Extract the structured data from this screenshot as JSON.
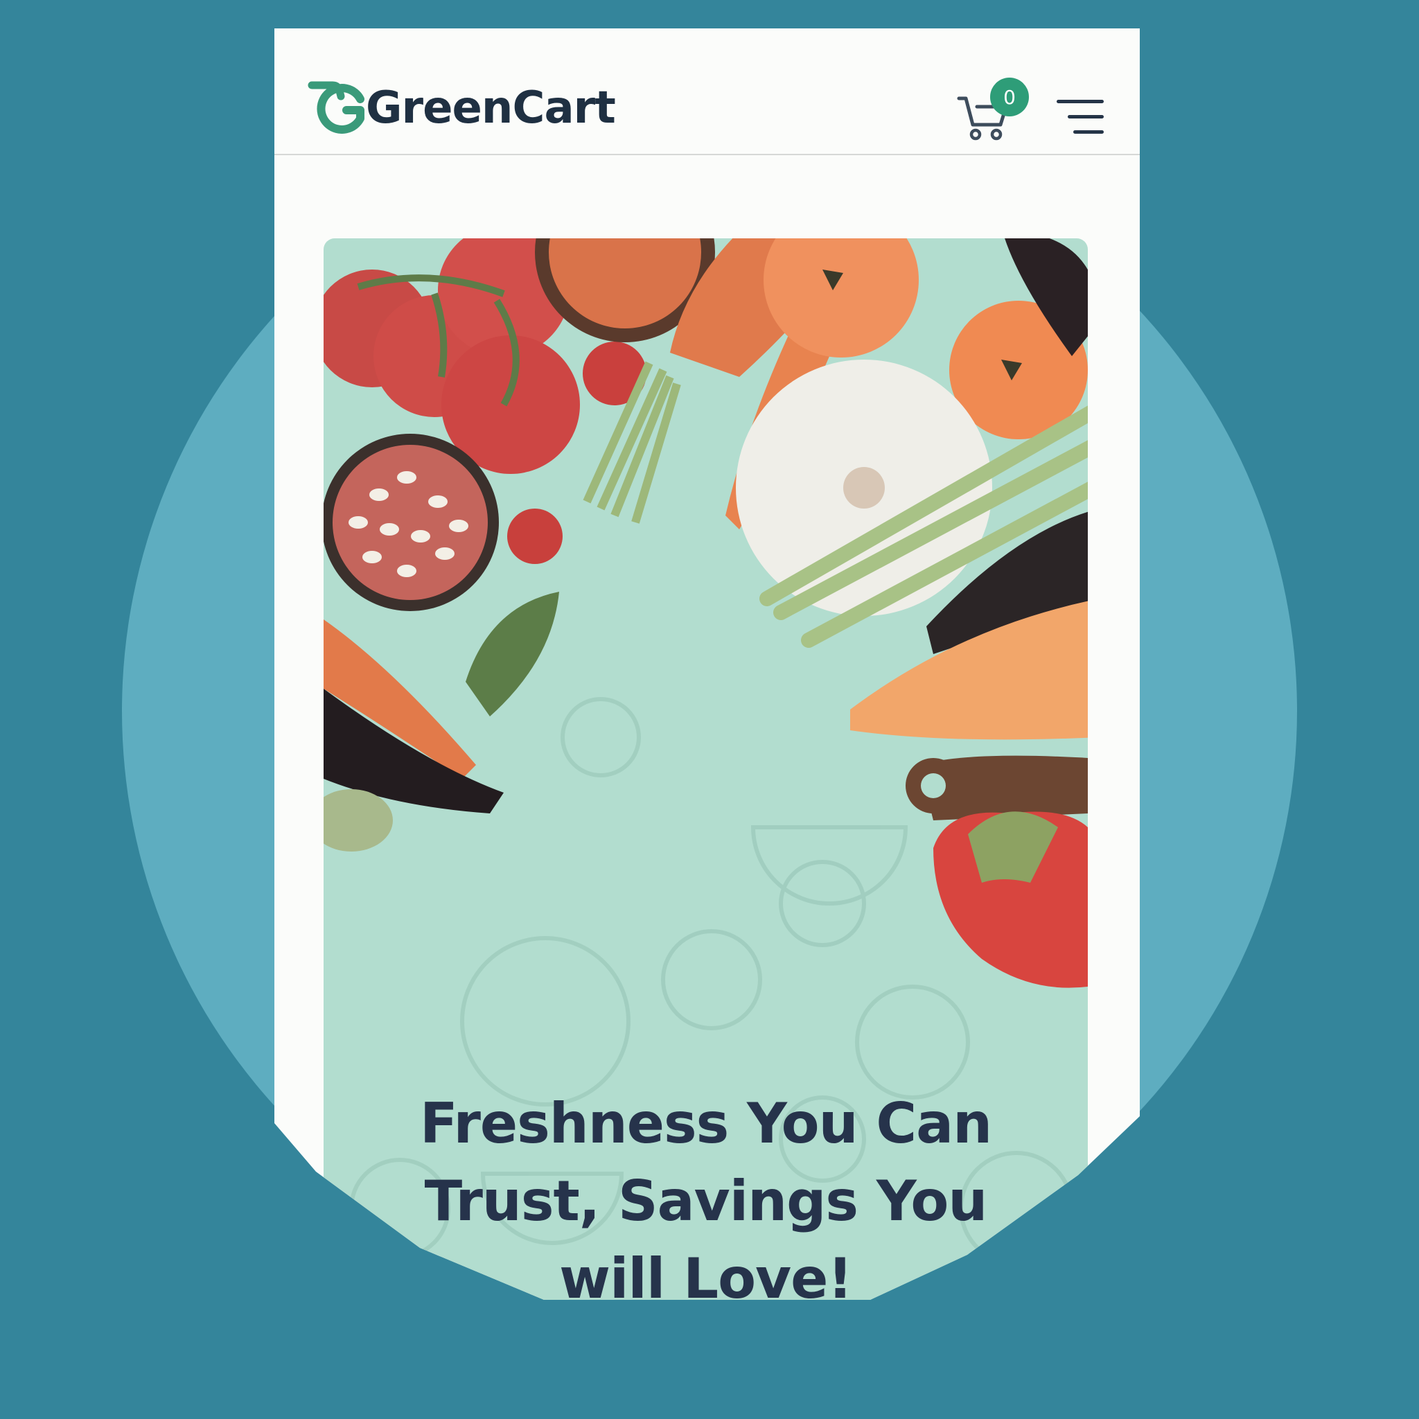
{
  "brand": {
    "name": "GreenCart",
    "logo_mark": "G-cart-logo-icon",
    "colors": {
      "brand_green": "#3a9a7a",
      "text_dark": "#1f3042",
      "badge_green": "#2e9d78"
    }
  },
  "header": {
    "cart": {
      "icon": "shopping-cart-icon",
      "count": "0"
    },
    "menu": {
      "icon": "hamburger-menu-icon"
    }
  },
  "hero": {
    "image": "fresh-vegetables-flat-lay",
    "title_lines": [
      "Freshness You Can",
      "Trust, Savings You",
      "will Love!"
    ],
    "background": "#b2ddcf"
  },
  "page": {
    "background": "#34859b",
    "accent_circle": "#5eadc0"
  }
}
